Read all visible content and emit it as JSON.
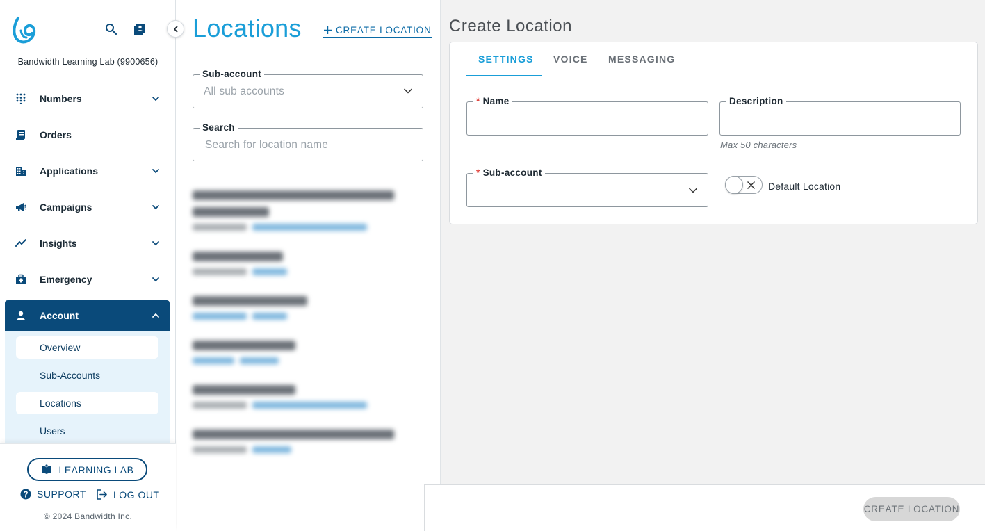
{
  "sidebar": {
    "org_name": "Bandwidth Learning Lab (9900656)",
    "items": [
      {
        "label": "Numbers",
        "icon": "dial-pad-icon"
      },
      {
        "label": "Orders",
        "icon": "orders-icon"
      },
      {
        "label": "Applications",
        "icon": "building-icon"
      },
      {
        "label": "Campaigns",
        "icon": "megaphone-icon"
      },
      {
        "label": "Insights",
        "icon": "trend-icon"
      },
      {
        "label": "Emergency",
        "icon": "first-aid-icon"
      },
      {
        "label": "Account",
        "icon": "person-icon"
      }
    ],
    "subitems": [
      "Overview",
      "Sub-Accounts",
      "Locations",
      "Users"
    ],
    "learning_lab": "LEARNING LAB",
    "support": "SUPPORT",
    "logout": "LOG OUT",
    "copyright": "© 2024 Bandwidth Inc."
  },
  "list": {
    "title": "Locations",
    "create_link": "CREATE LOCATION",
    "subaccount_label": "Sub-account",
    "subaccount_placeholder": "All sub accounts",
    "search_label": "Search",
    "search_placeholder": "Search for location name"
  },
  "form": {
    "title": "Create Location",
    "tabs": [
      "SETTINGS",
      "VOICE",
      "MESSAGING"
    ],
    "name_label": "Name",
    "description_label": "Description",
    "description_hint": "Max 50 characters",
    "subaccount_label": "Sub-account",
    "default_location_label": "Default Location",
    "default_location_on": false,
    "submit": "CREATE LOCATION"
  },
  "colors": {
    "brand_navy": "#0a4a7a",
    "accent_blue": "#1a9ed8",
    "required_red": "#e0403a"
  }
}
